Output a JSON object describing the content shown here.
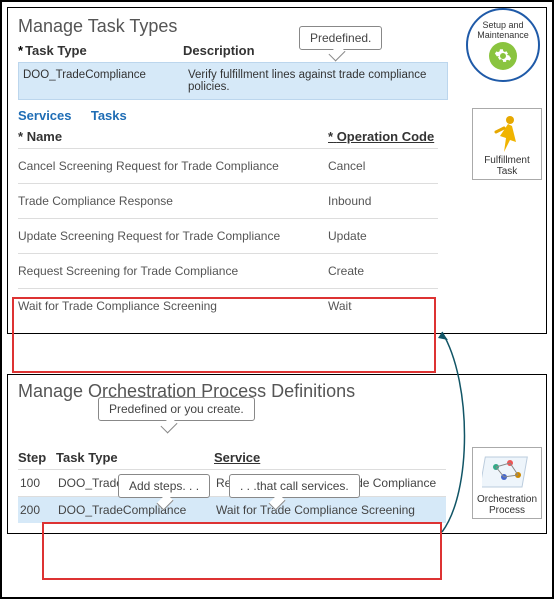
{
  "top": {
    "heading": "Manage Task Types",
    "cols": {
      "c1": "Task Type",
      "c2": "Description",
      "req": "*"
    },
    "row": {
      "tasktype": "DOO_TradeCompliance",
      "desc": "Verify fulfillment lines against trade compliance policies."
    },
    "tabs": {
      "t1": "Services",
      "t2": "Tasks"
    },
    "svc_cols": {
      "name": "Name",
      "op": "Operation Code",
      "req": "*"
    },
    "svc_rows": [
      {
        "name": "Cancel Screening Request for Trade Compliance",
        "op": "Cancel"
      },
      {
        "name": "Trade Compliance Response",
        "op": "Inbound"
      },
      {
        "name": "Update Screening Request for Trade Compliance",
        "op": "Update"
      },
      {
        "name": "Request Screening for Trade Compliance",
        "op": "Create"
      },
      {
        "name": "Wait for Trade Compliance Screening",
        "op": "Wait"
      }
    ]
  },
  "bottom": {
    "heading": "Manage Orchestration Process Definitions",
    "cols": {
      "step": "Step",
      "tasktype": "Task Type",
      "service": "Service"
    },
    "rows": [
      {
        "step": "100",
        "tasktype": "DOO_TradeCompliance",
        "service": "Request Screening for Trade Compliance"
      },
      {
        "step": "200",
        "tasktype": "DOO_TradeCompliance",
        "service": "Wait for Trade Compliance Screening"
      }
    ]
  },
  "callouts": {
    "predef": "Predefined.",
    "predef2": "Predefined  or you create.",
    "addsteps": "Add steps. . .",
    "callserv": ". . .that call services."
  },
  "badges": {
    "setup": "Setup and Maintenance",
    "fulfill": "Fulfillment Task",
    "orch": "Orchestration Process"
  }
}
